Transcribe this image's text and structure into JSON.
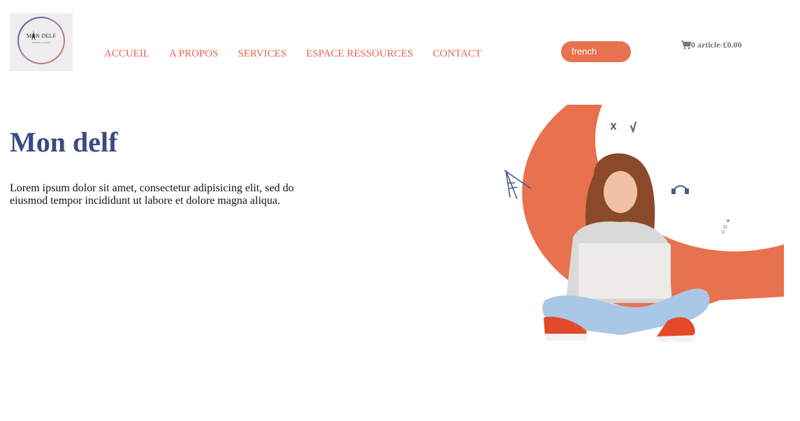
{
  "brand": {
    "logo_text": "MON DELF",
    "logo_tagline": "FRENCH AT EASE"
  },
  "nav": {
    "items": [
      {
        "label": "ACCUEIL"
      },
      {
        "label": "A PROPOS"
      },
      {
        "label": "SERVICES"
      },
      {
        "label": "ESPACE RESSOURCES"
      },
      {
        "label": "CONTACT"
      }
    ]
  },
  "search": {
    "value": "french"
  },
  "cart": {
    "label": "0 article-£0.00",
    "icon": "cart-icon"
  },
  "hero": {
    "title": "Mon delf",
    "text": "Lorem ipsum dolor sit amet, consectetur adipisicing elit, sed do eiusmod tempor incididunt ut labore et dolore magna aliqua."
  },
  "colors": {
    "accent": "#e8714e",
    "nav_text": "#e8624f",
    "title": "#3a4a85"
  }
}
